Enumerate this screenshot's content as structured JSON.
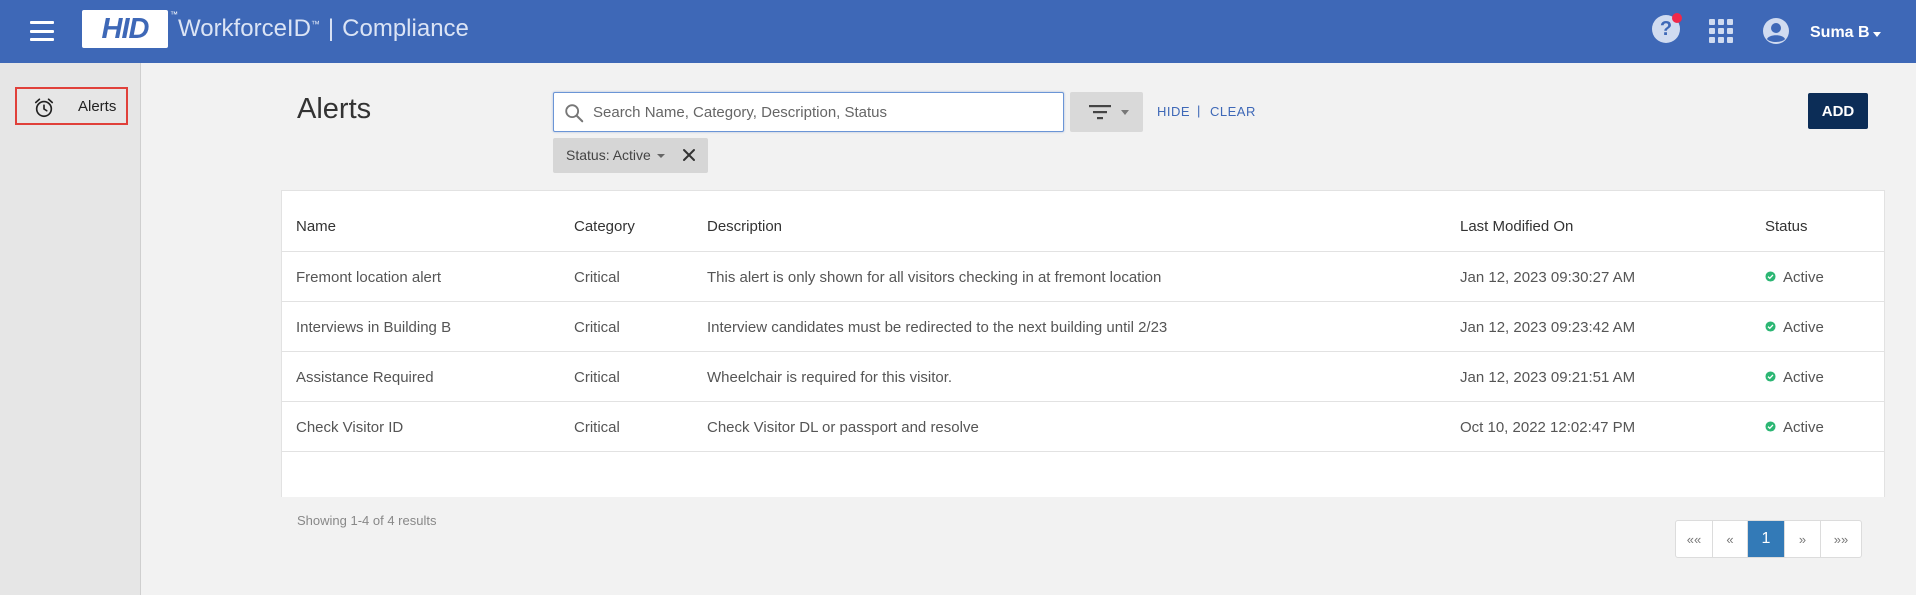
{
  "header": {
    "logo_text": "HID",
    "logo_tm": "™",
    "product": "WorkforceID",
    "product_tm": "™",
    "separator": "|",
    "module": "Compliance",
    "user_name": "Suma B",
    "help_glyph": "?",
    "icons": [
      "hamburger-menu-icon",
      "help-icon",
      "apps-grid-icon",
      "user-avatar-icon",
      "chevron-down-icon"
    ],
    "colors": {
      "bar": "#3e68b7",
      "notification": "#f0284a"
    }
  },
  "sidebar": {
    "items": [
      {
        "label": "Alerts",
        "icon": "alarm-clock-icon",
        "highlighted": true
      }
    ],
    "highlight_color": "#e0403a"
  },
  "main": {
    "title": "Alerts",
    "search": {
      "placeholder": "Search Name, Category, Description, Status",
      "value": ""
    },
    "hide_label": "HIDE",
    "link_separator": "|",
    "clear_label": "CLEAR",
    "add_label": "ADD",
    "filter_chip": {
      "label": "Status: Active",
      "close_glyph": "✕"
    },
    "accent_color": "#0c2d57"
  },
  "table": {
    "columns": [
      "Name",
      "Category",
      "Description",
      "Last Modified On",
      "Status"
    ],
    "rows": [
      {
        "name": "Fremont location alert",
        "category": "Critical",
        "description": "This alert is only shown for all visitors checking in at fremont location",
        "modified": "Jan 12, 2023 09:30:27 AM",
        "status": "Active"
      },
      {
        "name": "Interviews in Building B",
        "category": "Critical",
        "description": "Interview candidates must be redirected to the next building until 2/23",
        "modified": "Jan 12, 2023 09:23:42 AM",
        "status": "Active"
      },
      {
        "name": "Assistance Required",
        "category": "Critical",
        "description": "Wheelchair is required for this visitor.",
        "modified": "Jan 12, 2023 09:21:51 AM",
        "status": "Active"
      },
      {
        "name": "Check Visitor ID",
        "category": "Critical",
        "description": "Check Visitor DL or passport and resolve",
        "modified": "Oct 10, 2022 12:02:47 PM",
        "status": "Active"
      }
    ],
    "status_color": "#2bb673"
  },
  "footer": {
    "showing": "Showing 1-4 of 4 results",
    "pager": {
      "first": "««",
      "prev": "«",
      "current": "1",
      "next": "»",
      "last": "»»"
    }
  }
}
